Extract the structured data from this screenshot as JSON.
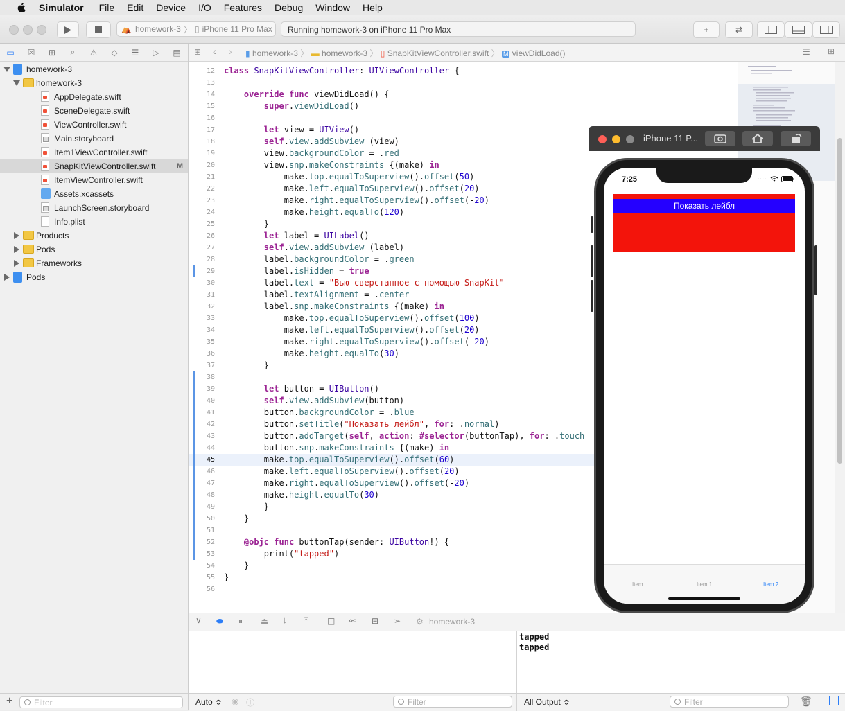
{
  "menubar": {
    "app": "Simulator",
    "items": [
      "File",
      "Edit",
      "Device",
      "I/O",
      "Features",
      "Debug",
      "Window",
      "Help"
    ]
  },
  "toolbar": {
    "scheme": "homework-3",
    "device": "iPhone 11 Pro Max",
    "status": "Running homework-3 on iPhone 11 Pro Max"
  },
  "navigator": {
    "items": [
      {
        "label": "homework-3",
        "kind": "project",
        "level": 0,
        "expanded": true
      },
      {
        "label": "homework-3",
        "kind": "folder",
        "level": 1,
        "expanded": true
      },
      {
        "label": "AppDelegate.swift",
        "kind": "swift",
        "level": 2
      },
      {
        "label": "SceneDelegate.swift",
        "kind": "swift",
        "level": 2
      },
      {
        "label": "ViewController.swift",
        "kind": "swift",
        "level": 2
      },
      {
        "label": "Main.storyboard",
        "kind": "storyboard",
        "level": 2
      },
      {
        "label": "Item1ViewController.swift",
        "kind": "swift",
        "level": 2
      },
      {
        "label": "SnapKitViewController.swift",
        "kind": "swift",
        "level": 2,
        "selected": true,
        "badge": "M"
      },
      {
        "label": "ItemViewController.swift",
        "kind": "swift",
        "level": 2
      },
      {
        "label": "Assets.xcassets",
        "kind": "assets",
        "level": 2
      },
      {
        "label": "LaunchScreen.storyboard",
        "kind": "storyboard",
        "level": 2
      },
      {
        "label": "Info.plist",
        "kind": "plist",
        "level": 2
      },
      {
        "label": "Products",
        "kind": "folder",
        "level": 1,
        "expanded": false
      },
      {
        "label": "Pods",
        "kind": "folder",
        "level": 1,
        "expanded": false
      },
      {
        "label": "Frameworks",
        "kind": "folder",
        "level": 1,
        "expanded": false
      },
      {
        "label": "Pods",
        "kind": "project",
        "level": 0,
        "expanded": false
      }
    ],
    "filter_placeholder": "Filter"
  },
  "jumpbar": {
    "crumbs": [
      "homework-3",
      "homework-3",
      "SnapKitViewController.swift",
      "viewDidLoad()"
    ]
  },
  "editor": {
    "current_line": 45,
    "lines": [
      {
        "n": 12,
        "t": "class SnapKitViewController: UIViewController {"
      },
      {
        "n": 13,
        "t": ""
      },
      {
        "n": 14,
        "t": "    override func viewDidLoad() {"
      },
      {
        "n": 15,
        "t": "        super.viewDidLoad()"
      },
      {
        "n": 16,
        "t": ""
      },
      {
        "n": 17,
        "t": "        let view = UIView()"
      },
      {
        "n": 18,
        "t": "        self.view.addSubview (view)"
      },
      {
        "n": 19,
        "t": "        view.backgroundColor = .red"
      },
      {
        "n": 20,
        "t": "        view.snp.makeConstraints {(make) in"
      },
      {
        "n": 21,
        "t": "            make.top.equalToSuperview().offset(50)"
      },
      {
        "n": 22,
        "t": "            make.left.equalToSuperview().offset(20)"
      },
      {
        "n": 23,
        "t": "            make.right.equalToSuperview().offset(-20)"
      },
      {
        "n": 24,
        "t": "            make.height.equalTo(120)"
      },
      {
        "n": 25,
        "t": "        }"
      },
      {
        "n": 26,
        "t": "        let label = UILabel()"
      },
      {
        "n": 27,
        "t": "        self.view.addSubview (label)"
      },
      {
        "n": 28,
        "t": "        label.backgroundColor = .green"
      },
      {
        "n": 29,
        "t": "        label.isHidden = true"
      },
      {
        "n": 30,
        "t": "        label.text = \"Вью сверстанное с помощью SnapKit\""
      },
      {
        "n": 31,
        "t": "        label.textAlignment = .center"
      },
      {
        "n": 32,
        "t": "        label.snp.makeConstraints {(make) in"
      },
      {
        "n": 33,
        "t": "            make.top.equalToSuperview().offset(100)"
      },
      {
        "n": 34,
        "t": "            make.left.equalToSuperview().offset(20)"
      },
      {
        "n": 35,
        "t": "            make.right.equalToSuperview().offset(-20)"
      },
      {
        "n": 36,
        "t": "            make.height.equalTo(30)"
      },
      {
        "n": 37,
        "t": "        }"
      },
      {
        "n": 38,
        "t": ""
      },
      {
        "n": 39,
        "t": "        let button = UIButton()"
      },
      {
        "n": 40,
        "t": "        self.view.addSubview(button)"
      },
      {
        "n": 41,
        "t": "        button.backgroundColor = .blue"
      },
      {
        "n": 42,
        "t": "        button.setTitle(\"Показать лейбл\", for: .normal)"
      },
      {
        "n": 43,
        "t": "        button.addTarget(self, action: #selector(buttonTap), for: .touch"
      },
      {
        "n": 44,
        "t": "        button.snp.makeConstraints {(make) in"
      },
      {
        "n": 45,
        "t": "        make.top.equalToSuperview().offset(60)"
      },
      {
        "n": 46,
        "t": "        make.left.equalToSuperview().offset(20)"
      },
      {
        "n": 47,
        "t": "        make.right.equalToSuperview().offset(-20)"
      },
      {
        "n": 48,
        "t": "        make.height.equalTo(30)"
      },
      {
        "n": 49,
        "t": "        }"
      },
      {
        "n": 50,
        "t": "    }"
      },
      {
        "n": 51,
        "t": ""
      },
      {
        "n": 52,
        "t": "    @objc func buttonTap(sender: UIButton!) {"
      },
      {
        "n": 53,
        "t": "        print(\"tapped\")"
      },
      {
        "n": 54,
        "t": "    }"
      },
      {
        "n": 55,
        "t": "}"
      },
      {
        "n": 56,
        "t": ""
      }
    ]
  },
  "debugbar": {
    "target": "homework-3"
  },
  "console": {
    "lines": [
      "tapped",
      "tapped"
    ]
  },
  "bottombar": {
    "auto_label": "Auto ≎",
    "output_label": "All Output ≎",
    "filter_placeholder": "Filter"
  },
  "simulator": {
    "title": "iPhone 11 P...",
    "time": "7:25",
    "button_title": "Показать лейбл",
    "tabs": [
      "Item",
      "Item 1",
      "Item 2"
    ],
    "active_tab": 2,
    "view_color": "#f3140b",
    "button_color": "#2500ff"
  },
  "colors": {
    "accent": "#2d7ef7",
    "keyword": "#9b2393",
    "string": "#c41a16",
    "number": "#1c00cf",
    "type": "#3900a0",
    "method": "#326d74"
  }
}
